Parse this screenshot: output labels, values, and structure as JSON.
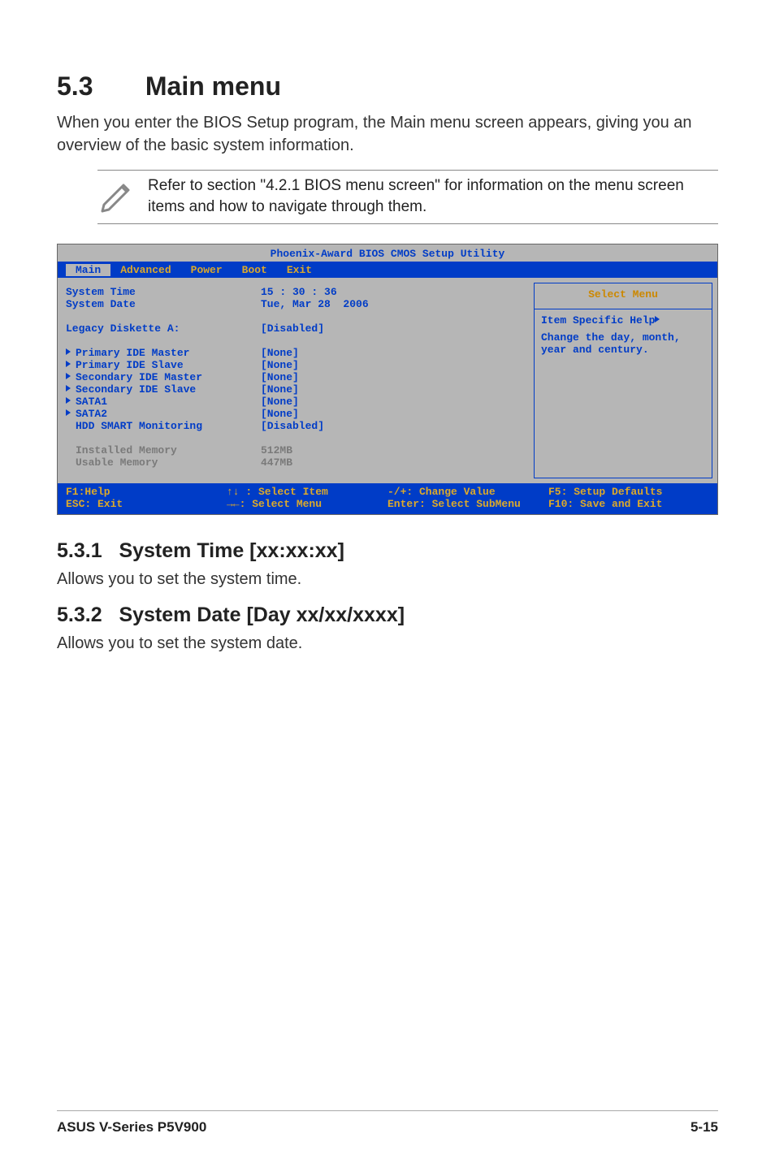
{
  "heading": {
    "num": "5.3",
    "title": "Main menu"
  },
  "intro": "When you enter the BIOS Setup program, the Main menu screen appears, giving you an overview of the basic system information.",
  "note": "Refer to section \"4.2.1 BIOS menu screen\" for information on the menu screen items and how to navigate through them.",
  "bios": {
    "title": "Phoenix-Award BIOS CMOS Setup Utility",
    "tabs": [
      "Main",
      "Advanced",
      "Power",
      "Boot",
      "Exit"
    ],
    "rows": {
      "system_time": {
        "label": "System Time",
        "value": "15 : 30 : 36"
      },
      "system_date": {
        "label": "System Date",
        "value": "Tue, Mar 28  2006"
      },
      "legacy_diskette": {
        "label": "Legacy Diskette A:",
        "value": "[Disabled]"
      },
      "pri_ide_master": {
        "label": "Primary IDE Master",
        "value": "[None]"
      },
      "pri_ide_slave": {
        "label": "Primary IDE Slave",
        "value": "[None]"
      },
      "sec_ide_master": {
        "label": "Secondary IDE Master",
        "value": "[None]"
      },
      "sec_ide_slave": {
        "label": "Secondary IDE Slave",
        "value": "[None]"
      },
      "sata1": {
        "label": "SATA1",
        "value": "[None]"
      },
      "sata2": {
        "label": "SATA2",
        "value": "[None]"
      },
      "hdd_smart": {
        "label": "HDD SMART Monitoring",
        "value": "[Disabled]"
      },
      "installed_mem": {
        "label": "Installed Memory",
        "value": "512MB"
      },
      "usable_mem": {
        "label": "Usable Memory",
        "value": "447MB"
      }
    },
    "help": {
      "title": "Select Menu",
      "line1": "Item Specific Help",
      "line2": "Change the day, month, year and century."
    },
    "footer": {
      "c1a": "F1:Help",
      "c1b": "ESC: Exit",
      "c2a": "↑↓ : Select Item",
      "c2b": "→←: Select Menu",
      "c3a": "-/+: Change Value",
      "c3b": "Enter: Select SubMenu",
      "c4a": "F5: Setup Defaults",
      "c4b": "F10: Save and Exit"
    }
  },
  "sub1": {
    "num": "5.3.1",
    "title": "System Time [xx:xx:xx]",
    "body": "Allows you to set the system time."
  },
  "sub2": {
    "num": "5.3.2",
    "title": "System Date [Day xx/xx/xxxx]",
    "body": "Allows you to set the system date."
  },
  "footer": {
    "left": "ASUS V-Series P5V900",
    "right": "5-15"
  }
}
